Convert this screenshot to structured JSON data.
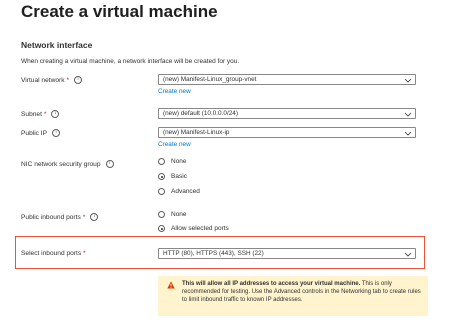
{
  "page": {
    "title": "Create a virtual machine",
    "more": "···"
  },
  "section": {
    "heading": "Network interface",
    "description": "When creating a virtual machine, a network interface will be created for you."
  },
  "fields": {
    "vnet": {
      "label": "Virtual network",
      "value": "(new) Manifest-Linux_group-vnet",
      "link": "Create new"
    },
    "subnet": {
      "label": "Subnet",
      "value": "(new) default (10.0.0.0/24)"
    },
    "public_ip": {
      "label": "Public IP",
      "value": "(new) Manifest-Linux-ip",
      "link": "Create new"
    },
    "nic_nsg": {
      "label": "NIC network security group",
      "options": [
        "None",
        "Basic",
        "Advanced"
      ],
      "selected": "Basic"
    },
    "inbound_ports": {
      "label": "Public inbound ports",
      "options": [
        "None",
        "Allow selected ports"
      ],
      "selected": "Allow selected ports"
    },
    "select_ports": {
      "label": "Select inbound ports",
      "value": "HTTP (80), HTTPS (443), SSH (22)"
    }
  },
  "warning": {
    "bold": "This will allow all IP addresses to access your virtual machine.",
    "text": " This is only recommended for testing. Use the Advanced controls in the Networking tab to create rules to limit inbound traffic to known IP addresses."
  },
  "colors": {
    "accent": "#0078d4",
    "highlight": "#e8533a",
    "warning_bg": "#fff4ce",
    "warning_icon": "#d83b01"
  }
}
